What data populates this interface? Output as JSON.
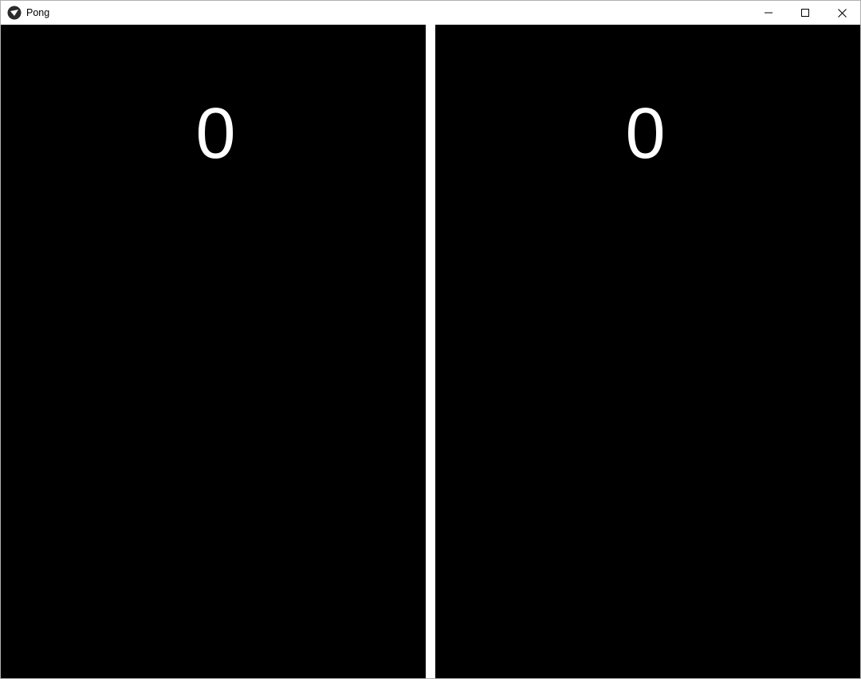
{
  "window": {
    "title": "Pong",
    "icon": "pong-app-icon"
  },
  "controls": {
    "minimize": "minimize",
    "maximize": "maximize",
    "close": "close"
  },
  "game": {
    "score_left": "0",
    "score_right": "0",
    "colors": {
      "background": "#000000",
      "foreground": "#ffffff"
    }
  }
}
